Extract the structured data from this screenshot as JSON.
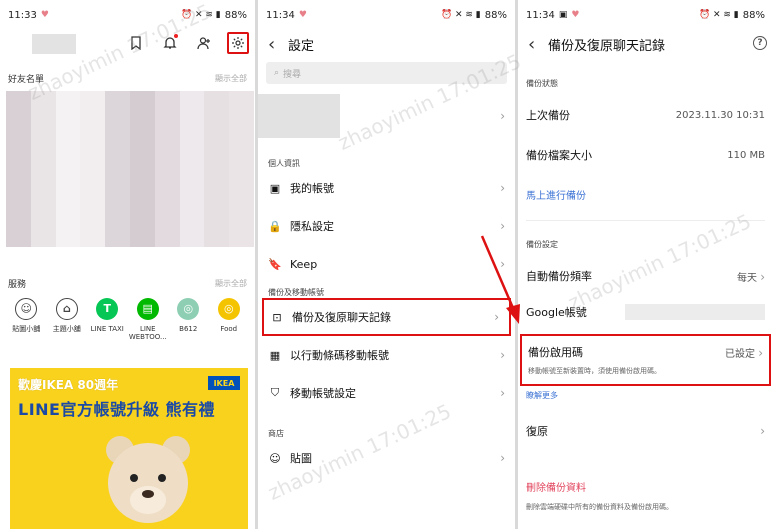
{
  "panel1": {
    "status": {
      "time": "11:33",
      "battery": "88%"
    },
    "friends_header": "好友名單",
    "show_all": "顯示全部",
    "services_header": "服務",
    "services_show_all": "顯示全部",
    "services": [
      {
        "label": "貼圖小舖",
        "icon": "smiley-icon"
      },
      {
        "label": "主題小舖",
        "icon": "brush-icon"
      },
      {
        "label": "LINE TAXI",
        "icon": "taxi-icon",
        "glyph": "T",
        "color": "#06c755"
      },
      {
        "label": "LINE WEBTOO...",
        "icon": "webtoon-icon",
        "glyph": "▤",
        "color": "#00b900"
      },
      {
        "label": "B612",
        "icon": "b612-icon",
        "glyph": "◎",
        "color": "#8ecfb4"
      },
      {
        "label": "Food",
        "icon": "food-icon",
        "glyph": "◎",
        "color": "#f5c400"
      }
    ],
    "banner": {
      "line1": "歡慶IKEA 80週年",
      "line2": "LINE官方帳號升級 熊有禮",
      "brand": "IKEA"
    }
  },
  "panel2": {
    "status": {
      "time": "11:34",
      "battery": "88%"
    },
    "title": "設定",
    "search_placeholder": "搜尋",
    "group_personal": "個人資訊",
    "group_backup": "備份及移動帳號",
    "group_shop": "商店",
    "items_personal": [
      {
        "label": "我的帳號",
        "icon": "id-card-icon"
      },
      {
        "label": "隱私設定",
        "icon": "lock-icon"
      },
      {
        "label": "Keep",
        "icon": "bookmark-icon"
      }
    ],
    "items_backup": [
      {
        "label": "備份及復原聊天記錄",
        "icon": "backup-icon"
      },
      {
        "label": "以行動條碼移動帳號",
        "icon": "qr-icon"
      },
      {
        "label": "移動帳號設定",
        "icon": "shield-icon"
      }
    ],
    "items_shop": [
      {
        "label": "貼圖",
        "icon": "smiley-icon"
      }
    ]
  },
  "panel3": {
    "status": {
      "time": "11:34",
      "battery": "88%"
    },
    "title": "備份及復原聊天記錄",
    "group_status": "備份狀態",
    "last_backup_label": "上次備份",
    "last_backup_value": "2023.11.30 10:31",
    "size_label": "備份檔案大小",
    "size_value": "110 MB",
    "backup_now": "馬上進行備份",
    "group_settings": "備份設定",
    "freq_label": "自動備份頻率",
    "freq_value": "每天",
    "google_label": "Google帳號",
    "pin_label": "備份啟用碼",
    "pin_value": "已設定",
    "pin_note": "移動帳號至新裝置時，須使用備份啟用碼。",
    "learn_more": "瞭解更多",
    "restore_label": "復原",
    "delete_label": "刪除備份資料",
    "delete_note": "刪除雲端硬碟中所有的備份資料及備份啟用碼。"
  },
  "watermark": "zhaoyimin  17:01:25",
  "colors": {
    "highlight": "#dd1111",
    "link": "#3b72d4",
    "danger": "#e2465e",
    "banner": "#f9d21e"
  }
}
